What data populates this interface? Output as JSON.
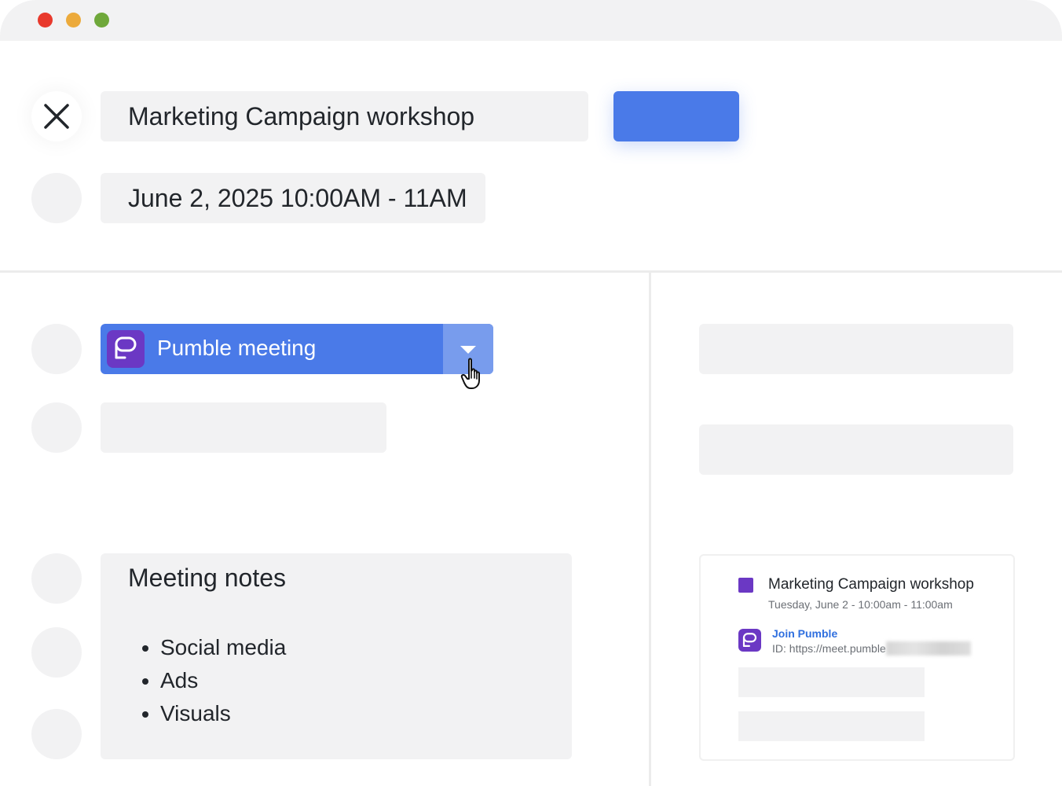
{
  "window": {
    "controls": [
      "close",
      "minimize",
      "maximize"
    ]
  },
  "event": {
    "title": "Marketing Campaign workshop",
    "datetime": "June 2, 2025 10:00AM - 11AM"
  },
  "conferencing": {
    "selected": "Pumble meeting",
    "icon": "pumble-logo-icon",
    "dropdown_icon": "caret-down-icon"
  },
  "notes": {
    "title": "Meeting notes",
    "items": [
      "Social media",
      "Ads",
      "Visuals"
    ]
  },
  "preview_card": {
    "title": "Marketing Campaign workshop",
    "time": "Tuesday, June 2 - 10:00am - 11:00am",
    "join_label": "Join Pumble",
    "id_text": "ID: https://meet.pumble"
  },
  "colors": {
    "accent": "#4a7ae8",
    "pumble_purple": "#6b38c4",
    "link": "#2f6fdf",
    "placeholder": "#f2f2f3"
  }
}
